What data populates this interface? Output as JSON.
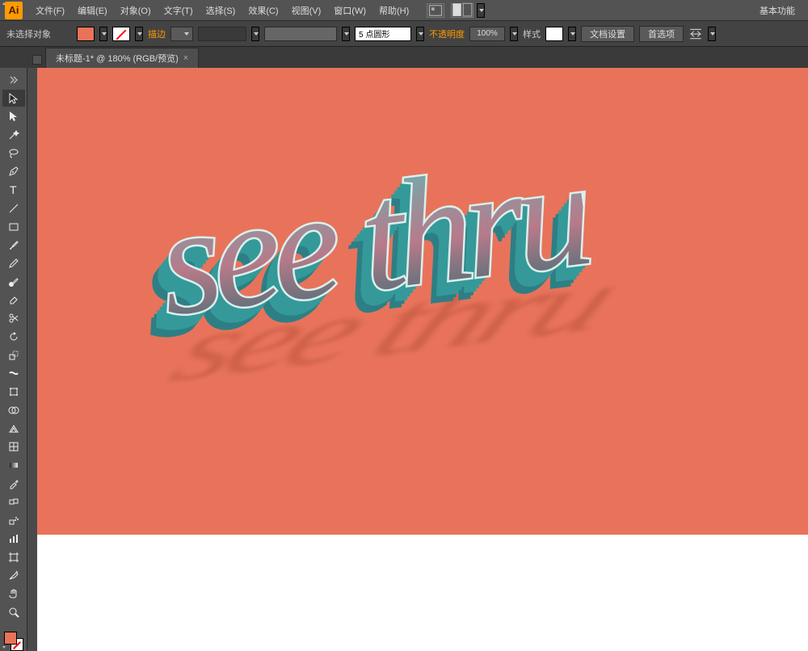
{
  "app": {
    "logo": "Ai"
  },
  "menu": {
    "file": "文件(F)",
    "edit": "编辑(E)",
    "object": "对象(O)",
    "type": "文字(T)",
    "select": "选择(S)",
    "effect": "效果(C)",
    "view": "视图(V)",
    "window": "窗口(W)",
    "help": "帮助(H)"
  },
  "workspace": "基本功能",
  "control": {
    "noselection": "未选择对象",
    "stroke": "描边",
    "strokewidth": "",
    "brushprofile": "5 点圆形",
    "opacity": "不透明度",
    "opacity_pct": "100%",
    "style": "样式",
    "docsetup": "文档设置",
    "prefs": "首选项"
  },
  "tab": {
    "title": "未标题-1* @ 180% (RGB/预览)",
    "close": "×"
  },
  "tools": [
    "selection",
    "direct-selection",
    "magic-wand",
    "lasso",
    "pen",
    "type",
    "line",
    "rectangle",
    "paintbrush",
    "pencil",
    "blob",
    "eraser",
    "rotate",
    "scale",
    "width",
    "free-transform",
    "shape-builder",
    "perspective",
    "mesh",
    "gradient",
    "eyedropper",
    "blend",
    "symbol-spray",
    "graph",
    "artboard",
    "slice",
    "hand",
    "zoom"
  ],
  "canvas": {
    "text": "see thru"
  }
}
